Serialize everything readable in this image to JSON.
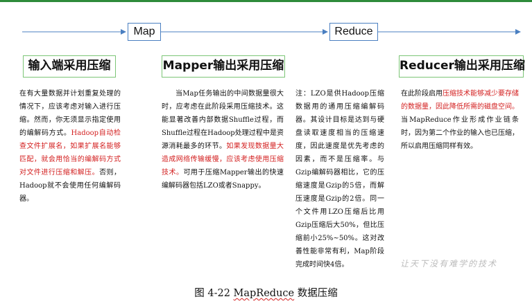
{
  "stages": {
    "map": "Map",
    "reduce": "Reduce"
  },
  "headings": {
    "input": "输入端采用压缩",
    "mapper": "Mapper输出采用压缩",
    "reducer": "Reducer输出采用压缩"
  },
  "columns": {
    "input": {
      "p1": "在有大量数据并计划重复处理的情况下，应该考虑对输入进行压缩。然而，你无须显示指定使用的编解码方式。",
      "red": "Hadoop自动检查文件扩展名，如果扩展名能够匹配，就会用恰当的编解码方式对文件进行压缩和解压。",
      "p2": "否则，Hadoop就不会使用任何编解码器。"
    },
    "mapper": {
      "p1": "当Map任务输出的中间数据量很大时，应考虑在此阶段采用压缩技术。这能显著改善内部数据Shuffle过程，而Shuffle过程在Hadoop处理过程中是资源消耗最多的环节。",
      "red": "如果发现数据量大造成网络传输缓慢，应该考虑使用压缩技术。",
      "p2": "可用于压缩Mapper输出的快速编解码器包括LZO或者Snappy。"
    },
    "note": {
      "p1": "注：LZO是供Hadoop压缩数据用的通用压缩编解码器。其设计目标是达到与硬盘读取速度相当的压缩速度，因此速度是优先考虑的因素，而不是压缩率。与Gzip编解码器相比，它的压缩速度是Gzip的5倍，而解压速度是Gzip的2倍。同一个文件用LZO压缩后比用Gzip压缩后大50%，但比压缩前小25%~50%。这对改善性能非常有利，Map阶段完成时间快4倍。"
    },
    "reducer": {
      "p1": "在此阶段启用",
      "red": "压缩技术能够减少要存储的数据量，因此降低所需的磁盘空间。",
      "p2": "当MapReduce作业形成作业链条时，因为第二个作业的输入也已压缩，所以启用压缩同样有效。"
    }
  },
  "watermark": "让天下没有难学的技术",
  "caption": {
    "prefix": "图 4-22 ",
    "term": "MapReduce",
    "suffix": " 数据压缩"
  },
  "colors": {
    "stage_border": "#4a7fc1",
    "heading_border": "#7cc576",
    "highlight": "#d32020",
    "top_rule": "#2e8b3a"
  }
}
